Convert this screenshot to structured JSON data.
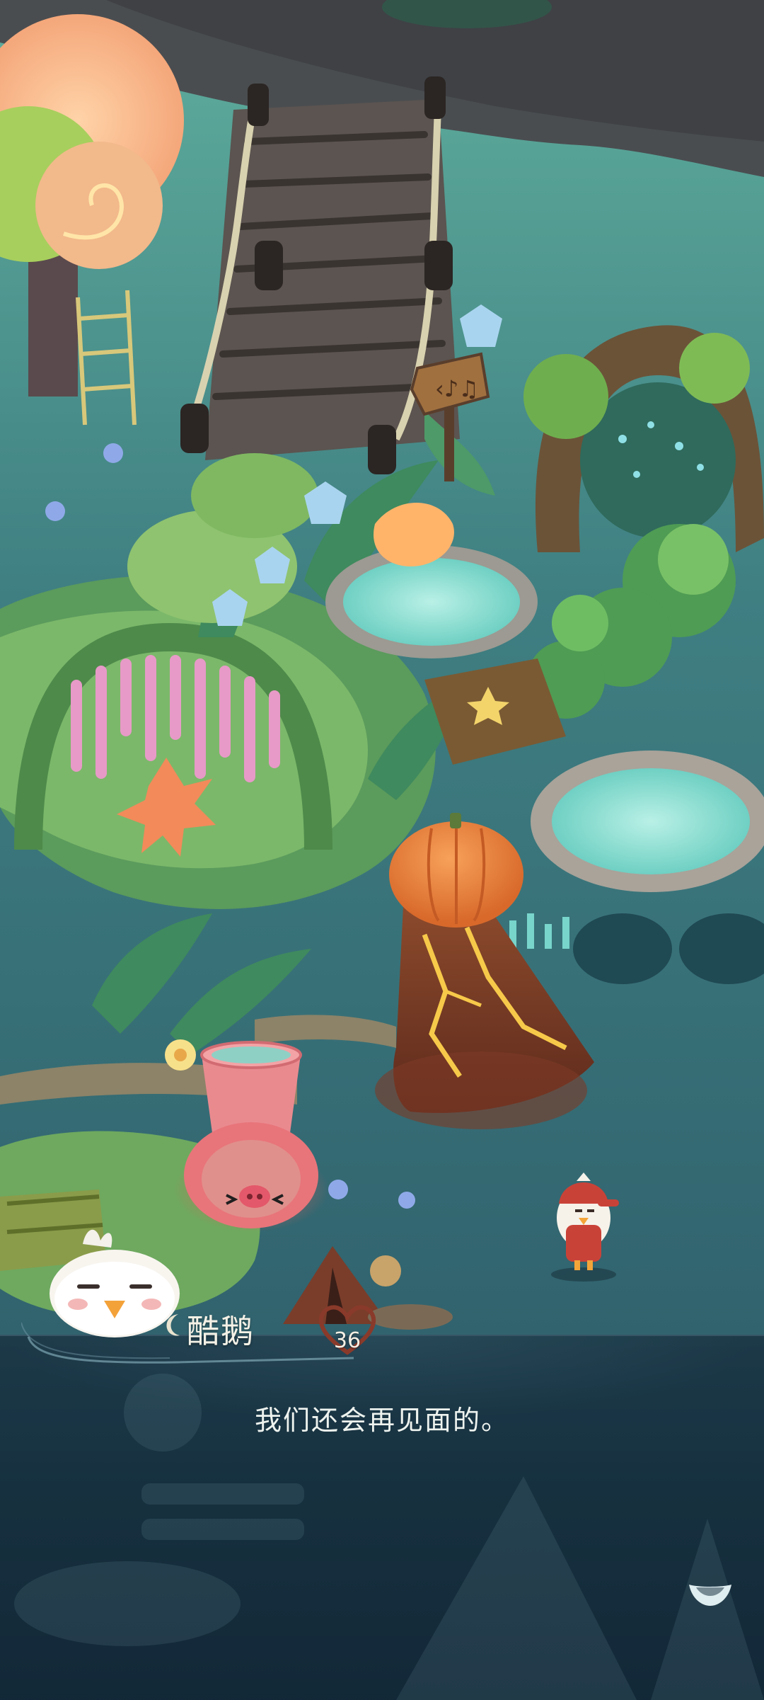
{
  "dialog": {
    "speaker_name": "酷鹅",
    "affinity": "36",
    "message": "我们还会再见面的。"
  },
  "icons": {
    "speaker_moon": "moon-icon",
    "affinity": "heart-icon",
    "continue": "chevron-down-icon"
  },
  "colors": {
    "dialog_background": "#1b3746",
    "name_text": "#f4f1e6",
    "heart": "#8a3a2a",
    "water": "#2f5c6a"
  }
}
